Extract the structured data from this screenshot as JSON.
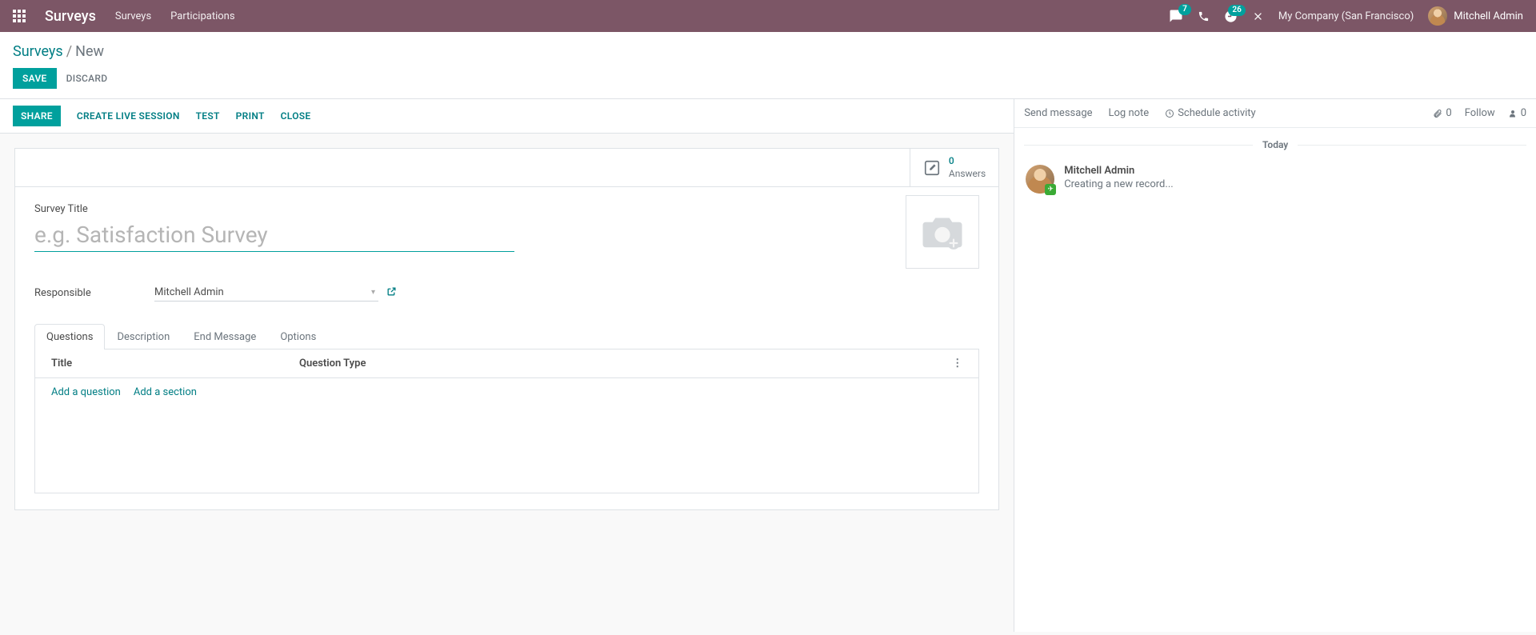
{
  "topbar": {
    "brand": "Surveys",
    "nav": {
      "surveys": "Surveys",
      "participations": "Participations"
    },
    "messages_badge": "7",
    "activities_badge": "26",
    "company": "My Company (San Francisco)",
    "user": "Mitchell Admin"
  },
  "breadcrumb": {
    "root": "Surveys",
    "current": "New"
  },
  "buttons": {
    "save": "SAVE",
    "discard": "DISCARD"
  },
  "actions": {
    "share": "SHARE",
    "create_live": "CREATE LIVE SESSION",
    "test": "TEST",
    "print": "PRINT",
    "close": "CLOSE"
  },
  "stat": {
    "count": "0",
    "label": "Answers"
  },
  "form": {
    "title_label": "Survey Title",
    "title_placeholder": "e.g. Satisfaction Survey",
    "title_value": "",
    "responsible_label": "Responsible",
    "responsible_value": "Mitchell Admin"
  },
  "tabs": {
    "questions": "Questions",
    "description": "Description",
    "end_message": "End Message",
    "options": "Options"
  },
  "questions_table": {
    "col_title": "Title",
    "col_type": "Question Type",
    "add_question": "Add a question",
    "add_section": "Add a section"
  },
  "chatter": {
    "send": "Send message",
    "log": "Log note",
    "schedule": "Schedule activity",
    "attachments": "0",
    "follow": "Follow",
    "followers": "0",
    "divider": "Today",
    "msg_author": "Mitchell Admin",
    "msg_text": "Creating a new record..."
  }
}
